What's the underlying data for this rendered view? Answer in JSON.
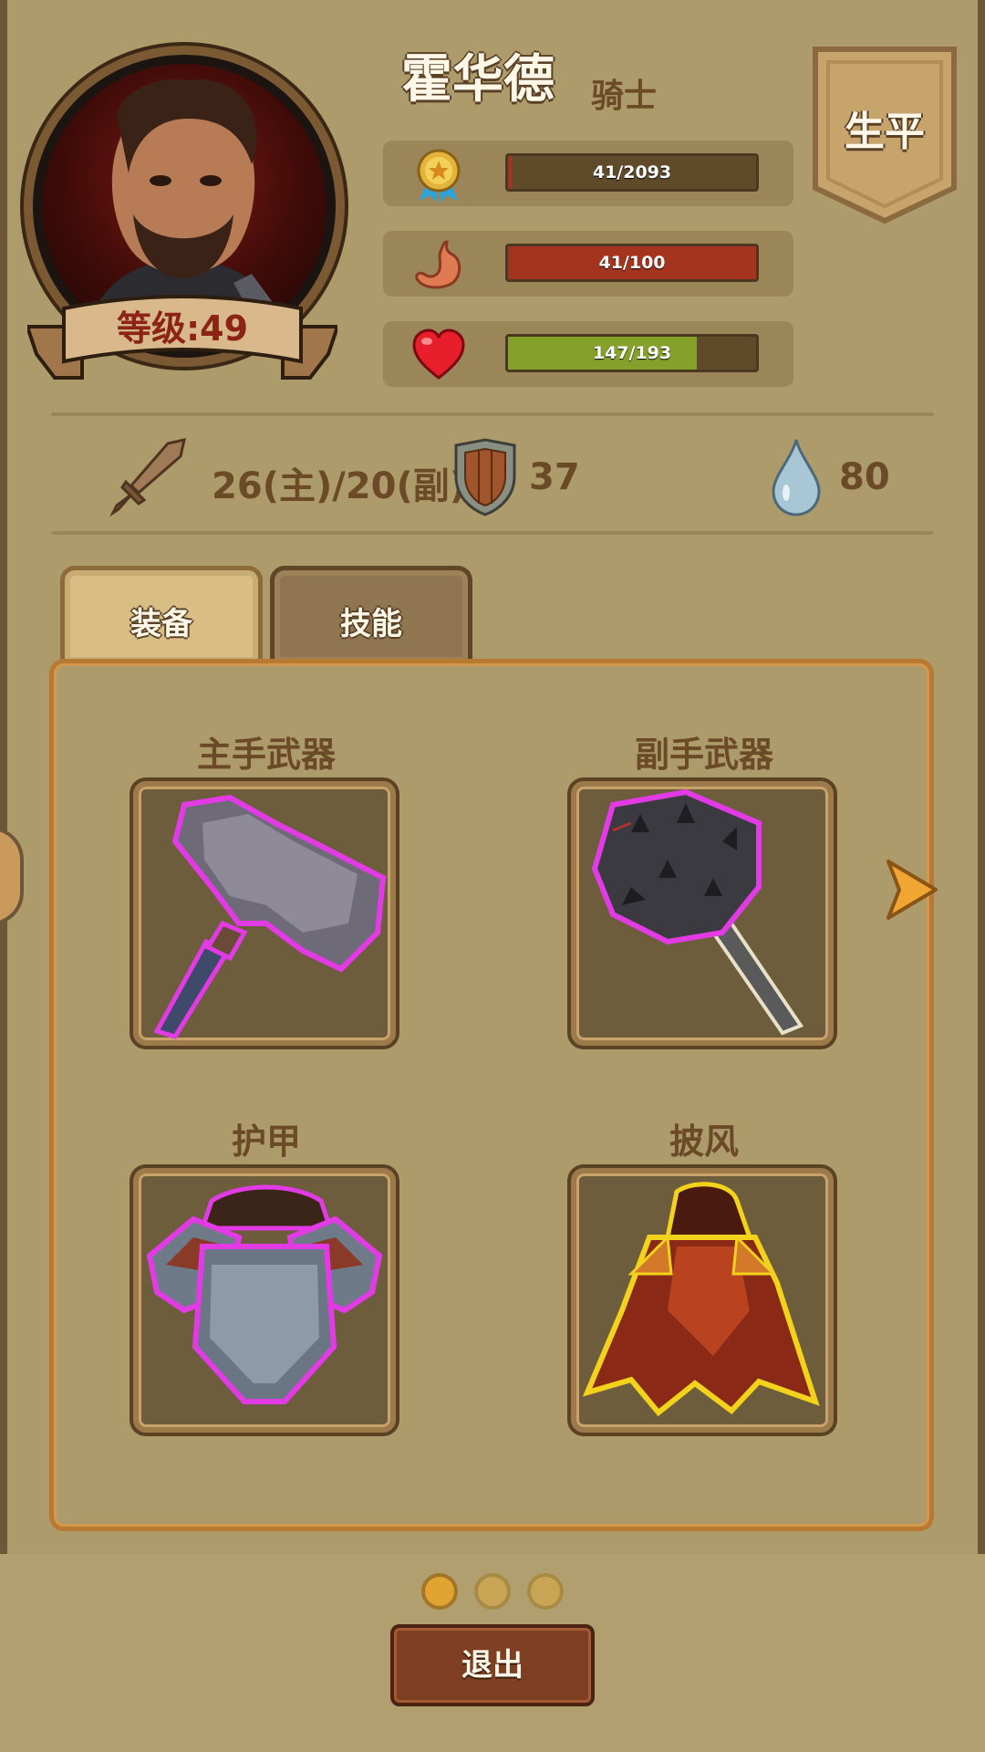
{
  "hero": {
    "name": "霍华德",
    "class": "骑士",
    "level_label": "等级:49"
  },
  "career_button": "生平",
  "stats": [
    {
      "icon": "medal-icon",
      "text": "41/2093",
      "fraction": 0.0196,
      "color": "#a5341e"
    },
    {
      "icon": "stomach-icon",
      "text": "41/100",
      "fraction": 1.0,
      "color": "#a5341e"
    },
    {
      "icon": "heart-icon",
      "text": "147/193",
      "fraction": 0.76,
      "color": "#86a12a"
    }
  ],
  "attributes": {
    "attack": "26(主)/20(副)",
    "defense": "37",
    "water": "80"
  },
  "tabs": {
    "equipment": "装备",
    "skills": "技能"
  },
  "slots": {
    "main_weapon": "主手武器",
    "off_weapon": "副手武器",
    "armor": "护甲",
    "cloak": "披风"
  },
  "pagination": {
    "total": 3,
    "active": 1
  },
  "exit_button": "退出",
  "colors": {
    "background": "#b29f70",
    "text_brown": "#6b4a27",
    "level_red": "#8b2417",
    "rarity_epic": "#e23be6",
    "rarity_legendary": "#f2d21a"
  }
}
